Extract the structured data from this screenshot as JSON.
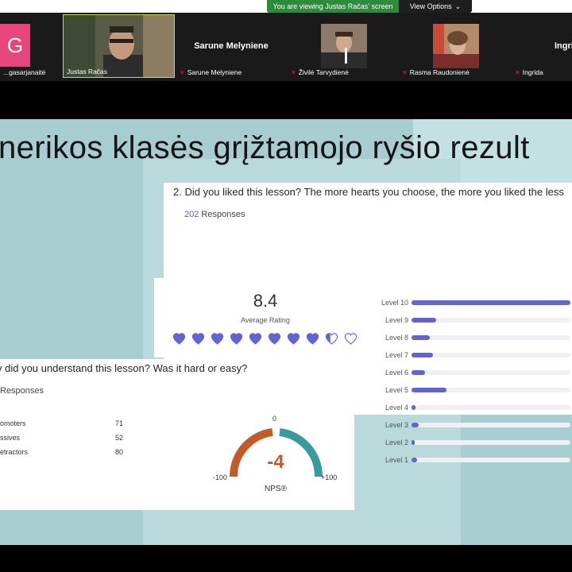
{
  "banner": {
    "viewing_text": "You are viewing Justas Račas' screen",
    "view_options_label": "View Options",
    "view_options_icon": "chevron-down-icon"
  },
  "participants": [
    {
      "name": "...gasarjanaitė",
      "initial": "G",
      "muted": false
    },
    {
      "name": "Justas Račas",
      "muted": false
    },
    {
      "name": "Sarune Melyniene",
      "display_name": "Sarune Melyniene",
      "muted": true
    },
    {
      "name": "Živilė Tarvydienė",
      "muted": true
    },
    {
      "name": "Rasma Raudonienė",
      "muted": true
    },
    {
      "name": "Ingrida",
      "display_name": "Ingri",
      "muted": true
    }
  ],
  "slide": {
    "title": "nerikos klasės grįžtamojo ryšio rezult"
  },
  "rating_question": {
    "question": "2. Did you liked this lesson? The more hearts you choose, the more you liked the less",
    "responses_count": "202",
    "responses_label": "Responses",
    "average": "8.4",
    "average_label": "Average Rating",
    "average_value": 8.4,
    "max_rating": 10,
    "levels": [
      {
        "label": "Level 10",
        "fraction": 1.0
      },
      {
        "label": "Level 9",
        "fraction": 0.155
      },
      {
        "label": "Level 8",
        "fraction": 0.115
      },
      {
        "label": "Level 7",
        "fraction": 0.135
      },
      {
        "label": "Level 6",
        "fraction": 0.085
      },
      {
        "label": "Level 5",
        "fraction": 0.22
      },
      {
        "label": "Level 4",
        "fraction": 0.025
      },
      {
        "label": "Level 3",
        "fraction": 0.045
      },
      {
        "label": "Level 2",
        "fraction": 0.012
      },
      {
        "label": "Level 1",
        "fraction": 0.035
      }
    ]
  },
  "nps_question": {
    "question": "v did you understand this lesson? Was it hard or easy?",
    "responses_label": "Responses",
    "rows": [
      {
        "label": "omoters",
        "value": "71"
      },
      {
        "label": "ssives",
        "value": "52"
      },
      {
        "label": "etractors",
        "value": "80"
      }
    ],
    "nps_value": "-4",
    "nps_label": "NPS®",
    "min_label": "-100",
    "max_label": "+100",
    "zero_label": "0",
    "colors": {
      "detractor": "#c25a2a",
      "promoter": "#3a9a9b"
    }
  }
}
